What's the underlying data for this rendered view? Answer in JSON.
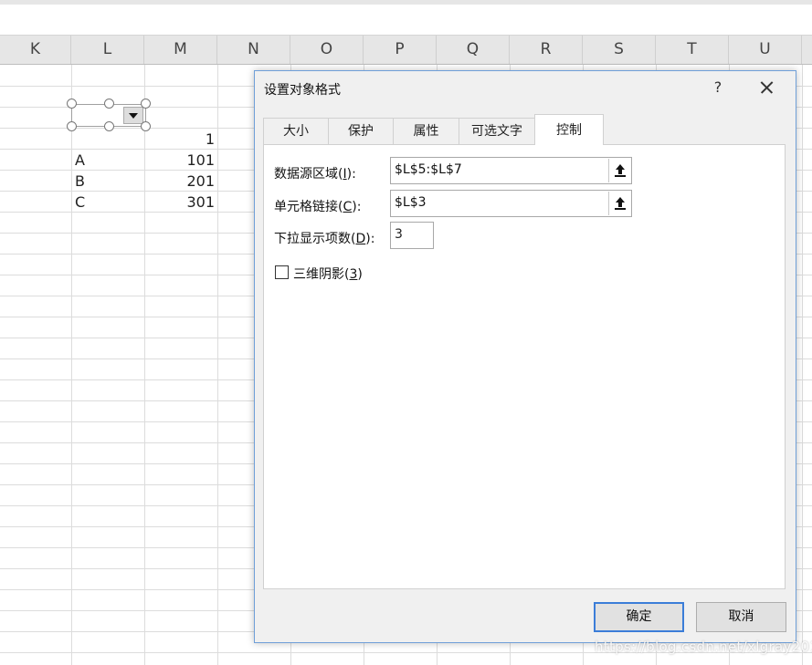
{
  "columns": [
    "K",
    "L",
    "M",
    "N",
    "O",
    "P",
    "Q",
    "R",
    "S",
    "T",
    "U"
  ],
  "cells": {
    "m_header_value": "1",
    "rows": [
      {
        "label": "A",
        "value": "101"
      },
      {
        "label": "B",
        "value": "201"
      },
      {
        "label": "C",
        "value": "301"
      }
    ]
  },
  "dialog": {
    "title": "设置对象格式",
    "help": "?",
    "tabs": [
      "大小",
      "保护",
      "属性",
      "可选文字",
      "控制"
    ],
    "active_tab": "控制",
    "input_range": {
      "label_pre": "数据源区域(",
      "label_key": "I",
      "label_post": "):",
      "value": "$L$5:$L$7"
    },
    "cell_link": {
      "label_pre": "单元格链接(",
      "label_key": "C",
      "label_post": "):",
      "value": "$L$3"
    },
    "dropdown_lines": {
      "label_pre": "下拉显示项数(",
      "label_key": "D",
      "label_post": "):",
      "value": "3"
    },
    "shading": {
      "label_pre": "三维阴影(",
      "label_key": "3",
      "label_post": ")",
      "checked": false
    },
    "ok_label": "确定",
    "cancel_label": "取消"
  },
  "watermark": "https://blog.csdn.net/xlgray2012",
  "colors": {
    "accent": "#3b7dd8",
    "grid": "#dcdcdc",
    "header_bg": "#e6e6e6"
  }
}
